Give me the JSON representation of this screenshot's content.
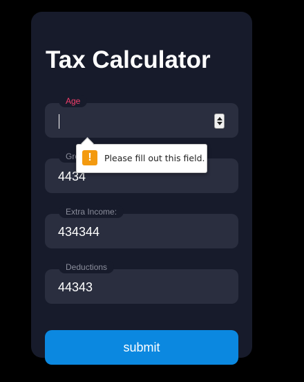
{
  "form": {
    "title": "Tax Calculator",
    "fields": [
      {
        "label": "Age",
        "value": "",
        "type": "number",
        "focused": true
      },
      {
        "label": "Gross Annual Income:",
        "value": "4434"
      },
      {
        "label": "Extra Income:",
        "value": "434344"
      },
      {
        "label": "Deductions",
        "value": "44343"
      }
    ],
    "submit_label": "submit"
  },
  "validation": {
    "message": "Please fill out this field.",
    "icon": "warning-icon",
    "icon_glyph": "!",
    "icon_color": "#f39a10"
  },
  "colors": {
    "background": "#000000",
    "card": "#171b2b",
    "field": "#2a2e3f",
    "active_label": "#f43f6b",
    "button": "#0b88e0"
  }
}
